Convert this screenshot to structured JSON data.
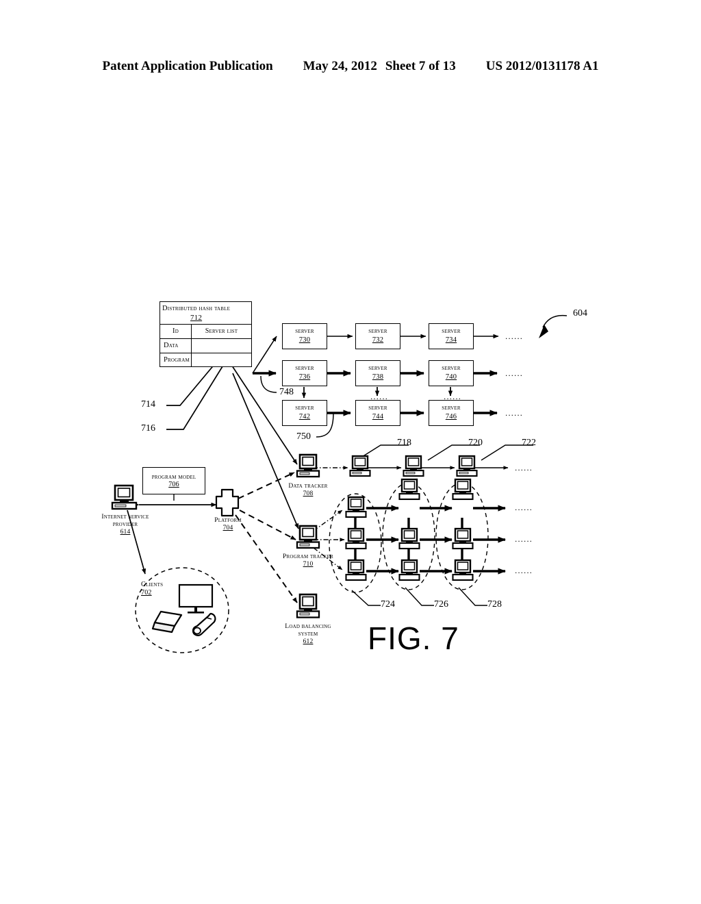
{
  "header": {
    "left": "Patent Application Publication",
    "date": "May 24, 2012",
    "sheet": "Sheet 7 of 13",
    "docnum": "US 2012/0131178 A1"
  },
  "figure": {
    "label": "FIG. 7",
    "system_ref": "604"
  },
  "dht": {
    "title": "Distributed Hash Table",
    "ref": "712",
    "columns": [
      "ID",
      "Server list"
    ],
    "rows": [
      {
        "id": "Data",
        "server_list": ""
      },
      {
        "id": "Program",
        "server_list": ""
      }
    ],
    "callouts": [
      "714",
      "716"
    ]
  },
  "servers": {
    "label": "Server",
    "grid": [
      [
        {
          "ref": "730"
        },
        {
          "ref": "732"
        },
        {
          "ref": "734"
        }
      ],
      [
        {
          "ref": "736"
        },
        {
          "ref": "738"
        },
        {
          "ref": "740"
        }
      ],
      [
        {
          "ref": "742"
        },
        {
          "ref": "744"
        },
        {
          "ref": "746"
        }
      ]
    ],
    "link_refs": [
      "748",
      "750"
    ],
    "continuation": "......"
  },
  "left_column": {
    "program_model": {
      "label": "Program Model",
      "ref": "706"
    },
    "isp": {
      "label": "Internet Service Provider",
      "ref": "614"
    },
    "platform": {
      "label": "Platform",
      "ref": "704"
    },
    "clients": {
      "label": "Clients",
      "ref": "702"
    }
  },
  "trackers": {
    "data_tracker": {
      "label": "Data Tracker",
      "ref": "708"
    },
    "program_tracker": {
      "label": "Program tracker",
      "ref": "710"
    },
    "load_balancer": {
      "label": "Load Balancing System",
      "ref": "612"
    }
  },
  "node_refs": {
    "data_row": [
      "718",
      "720",
      "722"
    ],
    "clusters": [
      "724",
      "726",
      "728"
    ]
  },
  "colors": {
    "ink": "#000000",
    "paper": "#ffffff"
  }
}
